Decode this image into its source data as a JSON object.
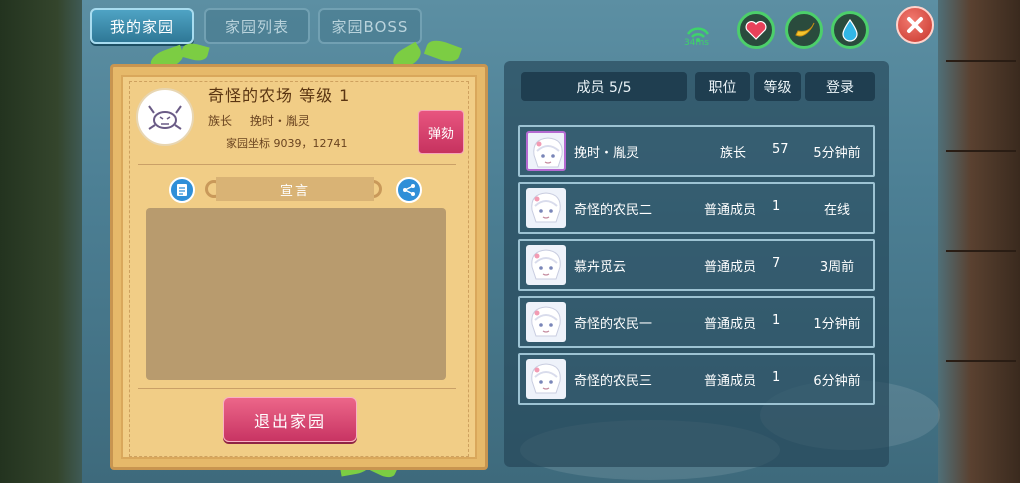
{
  "tabs": [
    {
      "label": "我的家园",
      "active": true
    },
    {
      "label": "家园列表",
      "active": false
    },
    {
      "label": "家园BOSS",
      "active": false
    }
  ],
  "status": {
    "ping": "34ms"
  },
  "header_icons": [
    "heart-icon",
    "banana-icon",
    "water-drop-icon",
    "close-icon"
  ],
  "home": {
    "name_line": "奇怪的农场  等级 1",
    "leader_label": "族长",
    "leader_name": "挽时・胤灵",
    "coord_text": "家园坐标 9039，12741",
    "impeach_label": "弹劾",
    "declaration_label": "宣言",
    "declaration_text": "",
    "quit_label": "退出家园"
  },
  "members": {
    "header": {
      "count": "成员 5/5",
      "position": "职位",
      "level": "等级",
      "login": "登录"
    },
    "rows": [
      {
        "name": "挽时・胤灵",
        "position": "族长",
        "level": "57",
        "login": "5分钟前",
        "self": true
      },
      {
        "name": "奇怪的农民二",
        "position": "普通成员",
        "level": "1",
        "login": "在线",
        "self": false
      },
      {
        "name": "慕卉觅云",
        "position": "普通成员",
        "level": "7",
        "login": "3周前",
        "self": false
      },
      {
        "name": "奇怪的农民一",
        "position": "普通成员",
        "level": "1",
        "login": "1分钟前",
        "self": false
      },
      {
        "name": "奇怪的农民三",
        "position": "普通成员",
        "level": "1",
        "login": "6分钟前",
        "self": false
      }
    ]
  },
  "colors": {
    "accent": "#2f8fd8",
    "danger": "#c83463",
    "online": "#3ed36a"
  }
}
